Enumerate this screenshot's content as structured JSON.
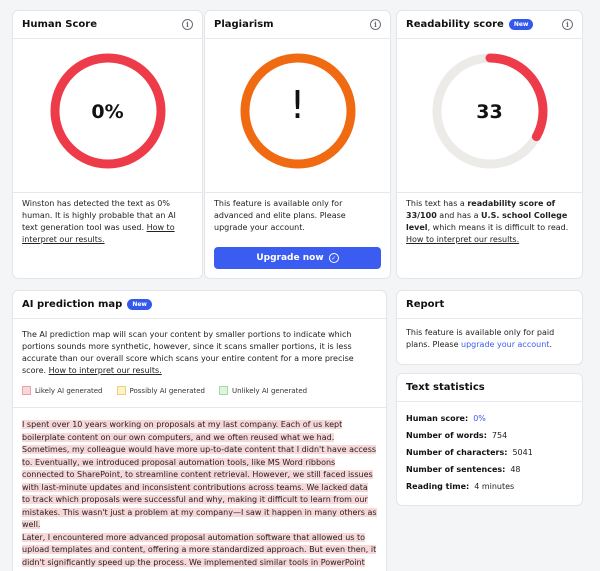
{
  "human_score": {
    "title": "Human Score",
    "info_icon": "info-icon",
    "value": "0%",
    "score_fraction": 1.0,
    "ring_color": "#ee3b4a",
    "text": "Winston has detected the text as 0% human. It is highly probable that an AI text generation tool was used. ",
    "link": "How to interpret our results."
  },
  "plagiarism": {
    "title": "Plagiarism",
    "info_icon": "info-icon",
    "symbol": "!",
    "ring_color": "#f06a12",
    "text": "This feature is available only for advanced and elite plans. Please upgrade your account.",
    "button_label": "Upgrade now",
    "button_icon": "check-circle-icon"
  },
  "readability": {
    "title": "Readability score",
    "badge": "New",
    "info_icon": "info-icon",
    "value": "33",
    "score_fraction": 0.33,
    "ring_color": "#ee3b4a",
    "track_color": "#ecebe8",
    "text_pre": "This text has a ",
    "text_bold1": "readability score of 33/100",
    "text_mid": " and has a ",
    "text_bold2": "U.S. school College level",
    "text_post": ", which means it is difficult to read. ",
    "link": "How to interpret our results."
  },
  "ai_map": {
    "title": "AI prediction map",
    "badge": "New",
    "intro": "The AI prediction map will scan your content by smaller portions to indicate which portions sounds more synthetic, however, since it scans smaller portions, it is less accurate than our overall score which scans your entire content for a more precise score. ",
    "intro_link": "How to interpret our results.",
    "legend": [
      {
        "label": "Likely AI generated",
        "fill": "#f8d7d9",
        "border": "#e9a3a8"
      },
      {
        "label": "Possibly AI generated",
        "fill": "#fdf3c4",
        "border": "#ead27a"
      },
      {
        "label": "Unlikely AI generated",
        "fill": "#ddf5dc",
        "border": "#a6dba3"
      }
    ],
    "paragraph1": "I spent over 10 years working on proposals at my last company. Each of us kept boilerplate content on our own computers, and we often reused what we had. Sometimes, my colleague would have more up-to-date content that I didn't have access to. Eventually, we introduced proposal automation tools, like MS Word ribbons connected to SharePoint, to streamline content retrieval. However, we still faced issues with last-minute updates and inconsistent contributions across teams. We lacked data to track which proposals were successful and why, making it difficult to learn from our mistakes. This wasn't just a problem at my company—I saw it happen in many others as well.",
    "paragraph2": "Later, I encountered more advanced proposal automation software that allowed us to upload templates and content, offering a more standardized approach. But even then, it didn't significantly speed up the process. We implemented similar tools in PowerPoint"
  },
  "report": {
    "title": "Report",
    "text_pre": "This feature is available only for paid plans. Please ",
    "link": "upgrade your account",
    "text_post": "."
  },
  "stats": {
    "title": "Text statistics",
    "rows": [
      {
        "key": "Human score:",
        "value": "0%"
      },
      {
        "key": "Number of words:",
        "value": "754"
      },
      {
        "key": "Number of characters:",
        "value": "5041"
      },
      {
        "key": "Number of sentences:",
        "value": "48"
      },
      {
        "key": "Reading time:",
        "value": "4 minutes"
      }
    ]
  }
}
